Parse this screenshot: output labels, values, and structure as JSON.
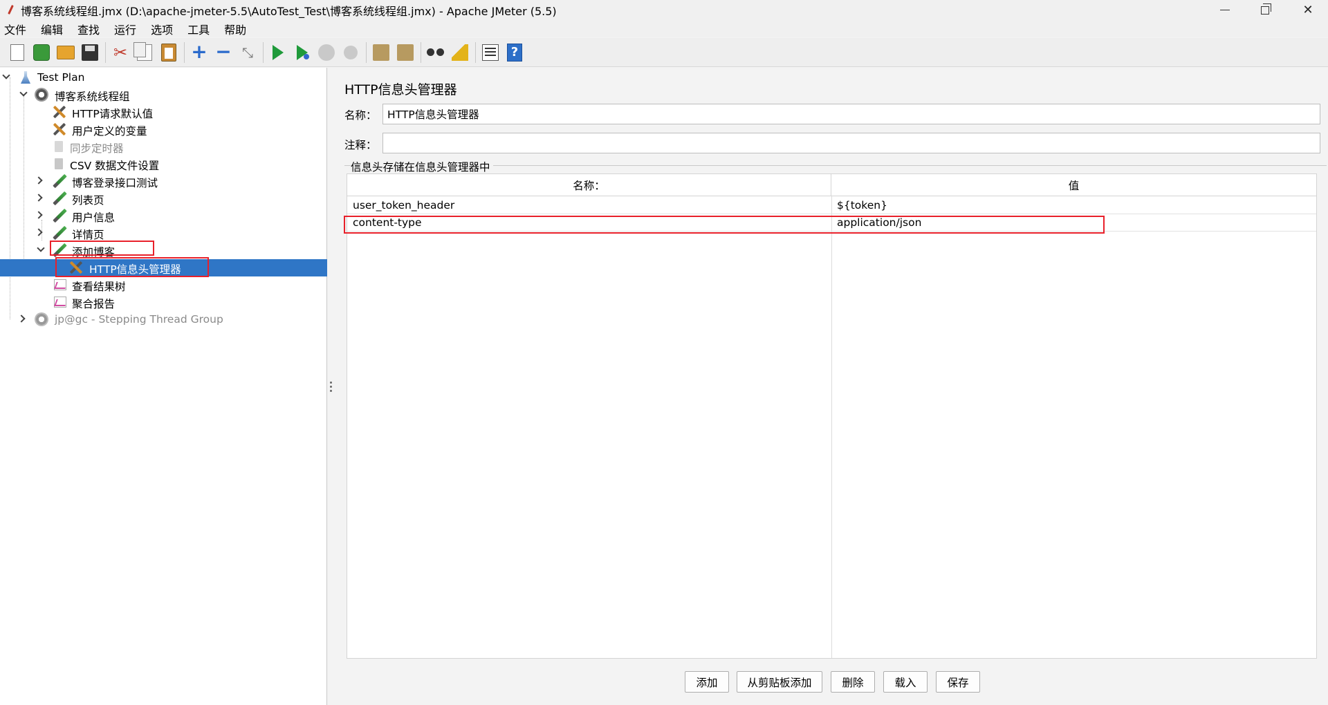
{
  "window": {
    "title": "博客系统线程组.jmx (D:\\apache-jmeter-5.5\\AutoTest_Test\\博客系统线程组.jmx) - Apache JMeter (5.5)"
  },
  "menu": [
    "文件",
    "编辑",
    "查找",
    "运行",
    "选项",
    "工具",
    "帮助"
  ],
  "toolbar": {
    "buttons": [
      {
        "icon": "new-icon"
      },
      {
        "icon": "templates-icon"
      },
      {
        "icon": "open-icon"
      },
      {
        "icon": "save-icon"
      },
      {
        "icon": "cut-icon"
      },
      {
        "icon": "copy-icon"
      },
      {
        "icon": "paste-icon"
      },
      {
        "icon": "expand-icon"
      },
      {
        "icon": "collapse-icon"
      },
      {
        "icon": "toggle-icon"
      },
      {
        "icon": "start-icon"
      },
      {
        "icon": "start-no-pauses-icon"
      },
      {
        "icon": "stop-icon"
      },
      {
        "icon": "shutdown-icon"
      },
      {
        "icon": "clear-icon"
      },
      {
        "icon": "clear-all-icon"
      },
      {
        "icon": "search-icon"
      },
      {
        "icon": "reset-search-icon"
      },
      {
        "icon": "function-helper-icon"
      },
      {
        "icon": "help-icon"
      }
    ],
    "cut_glyph": "✂",
    "expand_glyph": "+",
    "collapse_glyph": "−",
    "toggle_glyph": "⤡",
    "help_glyph": "?"
  },
  "tree": {
    "items": [
      {
        "label": "Test Plan",
        "icon": "flask-icon",
        "level": 0,
        "expander": "down"
      },
      {
        "label": "博客系统线程组",
        "icon": "gear-icon",
        "level": 1,
        "expander": "down"
      },
      {
        "label": "HTTP请求默认值",
        "icon": "wrench-icon",
        "level": 2,
        "expander": ""
      },
      {
        "label": "用户定义的变量",
        "icon": "wrench-icon",
        "level": 2,
        "expander": ""
      },
      {
        "label": "同步定时器",
        "icon": "timer-icon",
        "level": 2,
        "expander": "",
        "disabled": true
      },
      {
        "label": "CSV 数据文件设置",
        "icon": "csv-icon",
        "level": 2,
        "expander": ""
      },
      {
        "label": "博客登录接口测试",
        "icon": "sampler-icon",
        "level": 2,
        "expander": "right"
      },
      {
        "label": "列表页",
        "icon": "sampler-icon",
        "level": 2,
        "expander": "right"
      },
      {
        "label": "用户信息",
        "icon": "sampler-icon",
        "level": 2,
        "expander": "right"
      },
      {
        "label": "详情页",
        "icon": "sampler-icon",
        "level": 2,
        "expander": "right"
      },
      {
        "label": "添加博客",
        "icon": "sampler-icon",
        "level": 2,
        "expander": "down"
      },
      {
        "label": "HTTP信息头管理器",
        "icon": "wrench-icon",
        "level": 3,
        "expander": "",
        "selected": true
      },
      {
        "label": "查看结果树",
        "icon": "graph-icon",
        "level": 2,
        "expander": ""
      },
      {
        "label": "聚合报告",
        "icon": "graph-icon",
        "level": 2,
        "expander": ""
      },
      {
        "label": "jp@gc - Stepping Thread Group",
        "icon": "gear-icon",
        "level": 1,
        "expander": "right",
        "disabled": true
      }
    ]
  },
  "panel": {
    "title": "HTTP信息头管理器",
    "name_label": "名称：",
    "name_value": "HTTP信息头管理器",
    "comment_label": "注释：",
    "comment_value": "",
    "group_title": "信息头存储在信息头管理器中"
  },
  "table": {
    "columns": [
      "名称：",
      "值"
    ],
    "rows": [
      [
        "user_token_header",
        "${token}"
      ],
      [
        "content-type",
        "application/json"
      ]
    ]
  },
  "buttons": [
    "添加",
    "从剪贴板添加",
    "删除",
    "载入",
    "保存"
  ],
  "colors": {
    "selection": "#2f76c6",
    "highlight": "#e8202a"
  }
}
